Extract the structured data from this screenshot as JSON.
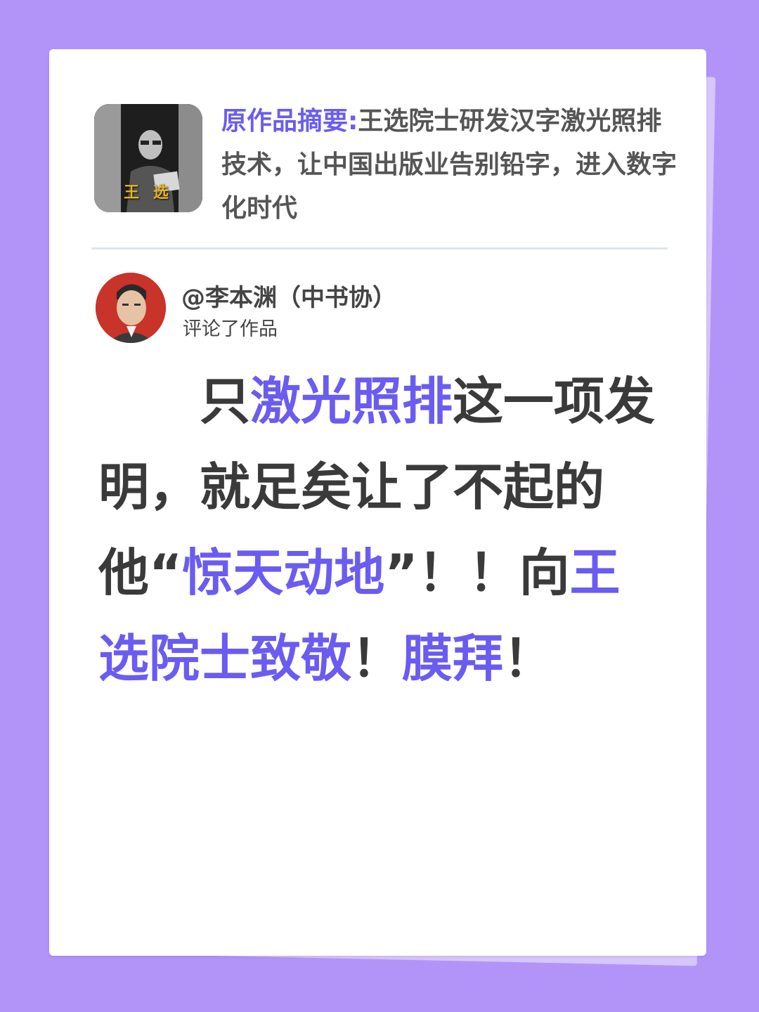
{
  "summary": {
    "label": "原作品摘要:",
    "text": "王选院士研发汉字激光照排技术，让中国出版业告别铅字，进入数字化时代"
  },
  "thumbnail": {
    "caption": "王 选"
  },
  "user": {
    "name": "@李本渊（中书协）",
    "action": "评论了作品"
  },
  "comment": {
    "p1": "只",
    "h1": "激光照排",
    "p2": "这一项发明，就足矣让了不起的他“",
    "h2": "惊天动地",
    "p3": "”！！向",
    "h3": "王选院士致敬",
    "p4": "！",
    "h4": "膜拜",
    "p5": "！"
  },
  "colors": {
    "background": "#b294f9",
    "accent": "#6a5cf0",
    "text": "#3a3a3a"
  }
}
